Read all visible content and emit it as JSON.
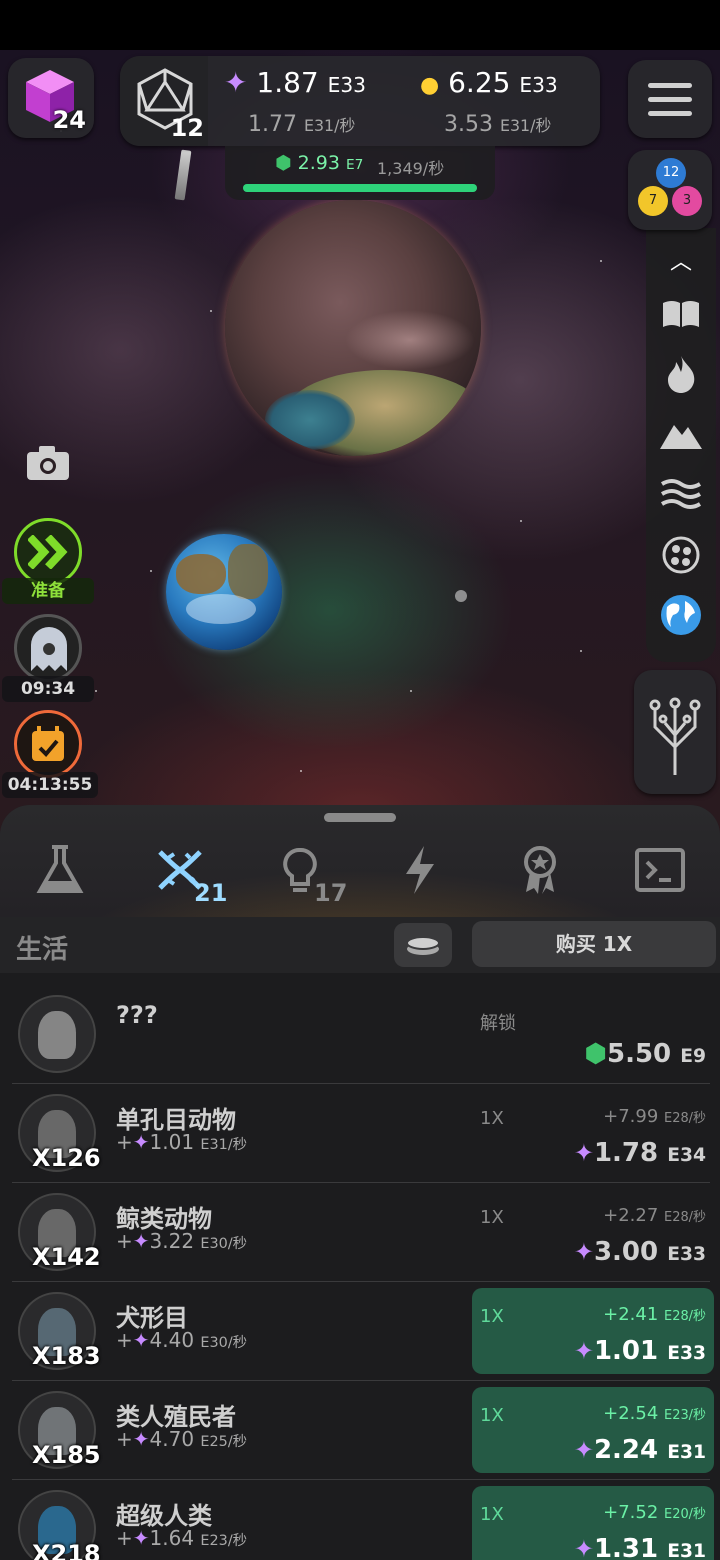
{
  "header": {
    "cube_level": "24",
    "dice_level": "12",
    "idea_value": "1.87",
    "idea_unit": "E33",
    "idea_rate": "1.77",
    "idea_rate_unit": "E31/秒",
    "science_value": "6.25",
    "science_unit": "E33",
    "science_rate": "3.53",
    "science_rate_unit": "E31/秒",
    "gem_value": "2.93",
    "gem_unit": "E7",
    "gem_rate": "1,349/秒",
    "gem_progress": 1.0
  },
  "badge": {
    "a": "12",
    "b": "7",
    "c": "3"
  },
  "left_tools": {
    "boost_label": "准备",
    "timer1": "09:34",
    "timer2": "04:13:55"
  },
  "tabs": {
    "dna_count": "21",
    "idea_count": "17"
  },
  "section": {
    "title": "生活",
    "buy_label": "购买 1X"
  },
  "rows": [
    {
      "name": "???",
      "count": "",
      "rate": "",
      "rate_unit": "",
      "mult": "解锁",
      "inc": "",
      "inc_unit": "",
      "cost": "5.50",
      "cost_unit": "E9",
      "cost_icon": "gem",
      "active": false
    },
    {
      "name": "单孔目动物",
      "count": "X126",
      "rate": "1.01",
      "rate_unit": "E31/秒",
      "mult": "1X",
      "inc": "+7.99",
      "inc_unit": "E28/秒",
      "cost": "1.78",
      "cost_unit": "E34",
      "cost_icon": "idea",
      "active": false
    },
    {
      "name": "鲸类动物",
      "count": "X142",
      "rate": "3.22",
      "rate_unit": "E30/秒",
      "mult": "1X",
      "inc": "+2.27",
      "inc_unit": "E28/秒",
      "cost": "3.00",
      "cost_unit": "E33",
      "cost_icon": "idea",
      "active": false
    },
    {
      "name": "犬形目",
      "count": "X183",
      "rate": "4.40",
      "rate_unit": "E30/秒",
      "mult": "1X",
      "inc": "+2.41",
      "inc_unit": "E28/秒",
      "cost": "1.01",
      "cost_unit": "E33",
      "cost_icon": "idea",
      "active": true
    },
    {
      "name": "类人殖民者",
      "count": "X185",
      "rate": "4.70",
      "rate_unit": "E25/秒",
      "mult": "1X",
      "inc": "+2.54",
      "inc_unit": "E23/秒",
      "cost": "2.24",
      "cost_unit": "E31",
      "cost_icon": "idea",
      "active": true
    },
    {
      "name": "超级人类",
      "count": "X218",
      "rate": "1.64",
      "rate_unit": "E23/秒",
      "mult": "1X",
      "inc": "+7.52",
      "inc_unit": "E20/秒",
      "cost": "1.31",
      "cost_unit": "E31",
      "cost_icon": "idea",
      "active": true
    }
  ],
  "colors": {
    "green": "#255a45",
    "accent_green": "#6bf0a6",
    "panel": "#28282c"
  }
}
